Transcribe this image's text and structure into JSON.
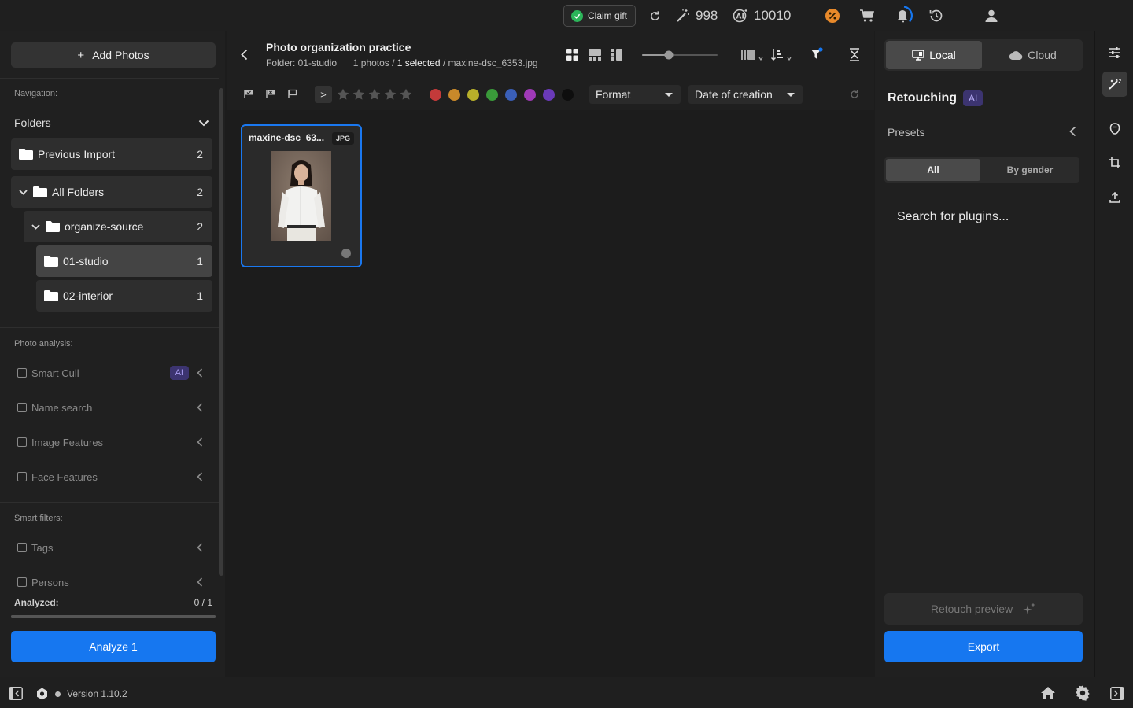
{
  "topbar": {
    "claim_gift": "Claim gift",
    "credits_magic": "998",
    "credits_ai": "10010"
  },
  "left": {
    "add_photos": "Add Photos",
    "navigation_label": "Navigation:",
    "folders_label": "Folders",
    "folders": [
      {
        "label": "Previous Import",
        "count": "2"
      },
      {
        "label": "All Folders",
        "count": "2"
      },
      {
        "label": "organize-source",
        "count": "2"
      },
      {
        "label": "01-studio",
        "count": "1"
      },
      {
        "label": "02-interior",
        "count": "1"
      }
    ],
    "photo_analysis_label": "Photo analysis:",
    "analysis_items": [
      {
        "label": "Smart Cull",
        "badge": "AI"
      },
      {
        "label": "Name search"
      },
      {
        "label": "Image Features"
      },
      {
        "label": "Face Features"
      }
    ],
    "smart_filters_label": "Smart filters:",
    "filter_items": [
      {
        "label": "Tags"
      },
      {
        "label": "Persons"
      }
    ],
    "analyzed_label": "Analyzed:",
    "analyzed_value": "0 / 1",
    "analyzed_progress": 0,
    "analyze_button": "Analyze 1"
  },
  "center": {
    "title": "Photo organization practice",
    "folder_text": "Folder: 01-studio",
    "photos_text": "1 photos /",
    "selected_text": "1 selected",
    "file_text": "/ maxine-dsc_6353.jpg",
    "rating_operator": "≥",
    "color_labels": [
      "#c33a3a",
      "#c9892a",
      "#b8b02a",
      "#3a9a3a",
      "#3a5fb8",
      "#a03ab8",
      "#6a3ab8",
      "#0e0e0e"
    ],
    "format_dropdown": "Format",
    "sort_dropdown": "Date of creation",
    "thumbnail": {
      "name": "maxine-dsc_63...",
      "format": "JPG"
    }
  },
  "right": {
    "local_tab": "Local",
    "cloud_tab": "Cloud",
    "title": "Retouching",
    "title_badge": "AI",
    "presets_label": "Presets",
    "tab_all": "All",
    "tab_gender": "By gender",
    "plugin_search": "Search for plugins...",
    "retouch_preview": "Retouch preview",
    "export": "Export"
  },
  "status": {
    "version": "Version 1.10.2"
  },
  "colors": {
    "accent": "#1677f0",
    "ai_badge": "#3c3470",
    "success": "#2cb55a"
  }
}
